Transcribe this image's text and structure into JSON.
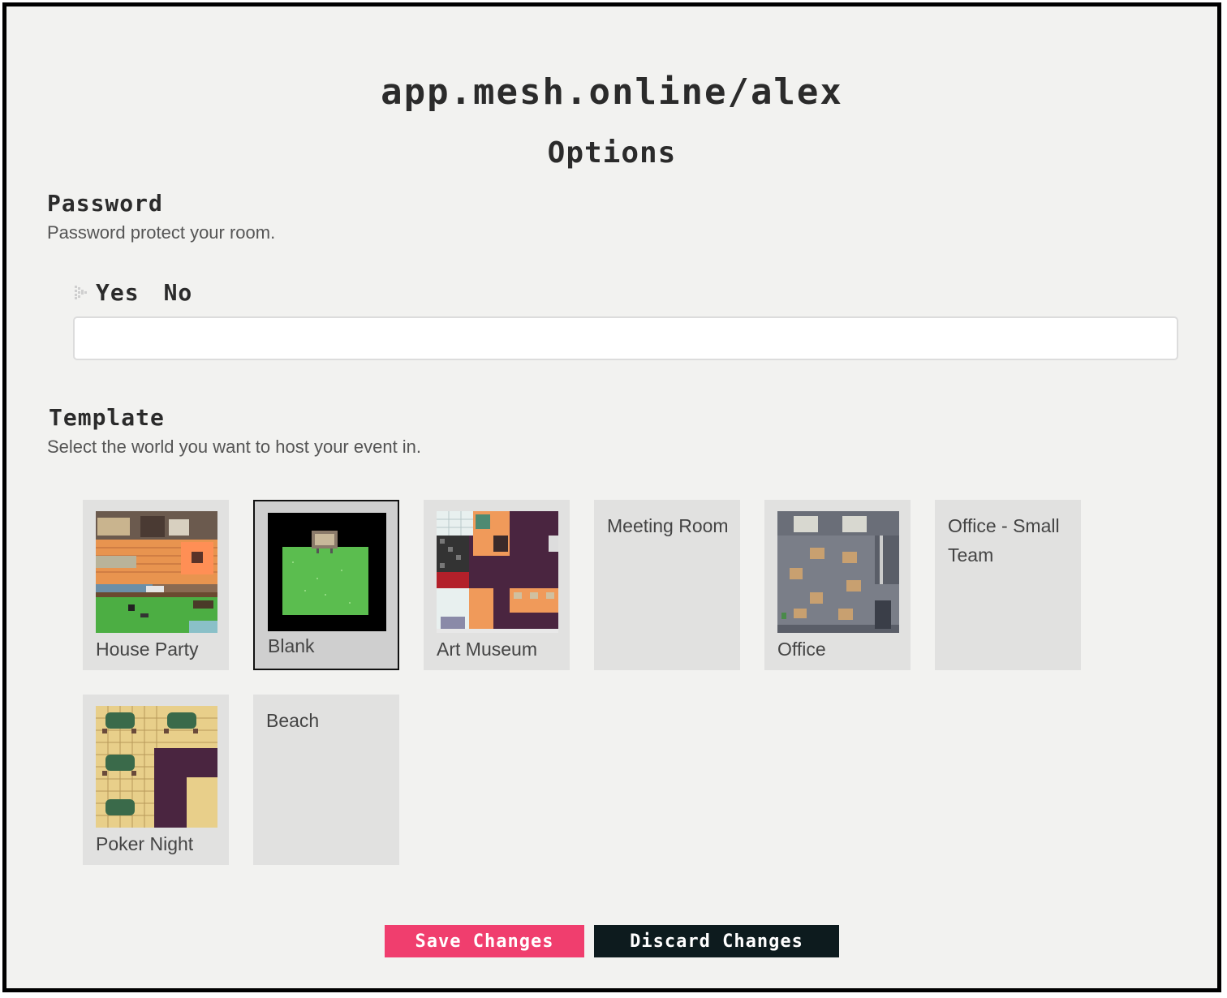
{
  "header": {
    "url": "app.mesh.online/alex",
    "subtitle": "Options"
  },
  "password": {
    "title": "Password",
    "description": "Password protect your room.",
    "options": [
      "Yes",
      "No"
    ],
    "selected": "Yes",
    "input_value": ""
  },
  "template": {
    "title": "Template",
    "description": "Select the world you want to host your event in.",
    "selected": "Blank",
    "items": [
      {
        "label": "House Party",
        "has_thumbnail": true
      },
      {
        "label": "Blank",
        "has_thumbnail": true
      },
      {
        "label": "Art Museum",
        "has_thumbnail": true
      },
      {
        "label": "Meeting Room",
        "has_thumbnail": false
      },
      {
        "label": "Office",
        "has_thumbnail": true
      },
      {
        "label": "Office - Small Team",
        "has_thumbnail": false
      },
      {
        "label": "Poker Night",
        "has_thumbnail": true
      },
      {
        "label": "Beach",
        "has_thumbnail": false
      }
    ]
  },
  "actions": {
    "save_label": "Save Changes",
    "discard_label": "Discard Changes"
  },
  "colors": {
    "save": "#f03e6e",
    "discard": "#0d1b1e",
    "background": "#f2f2f0",
    "card": "#e1e1e0"
  }
}
